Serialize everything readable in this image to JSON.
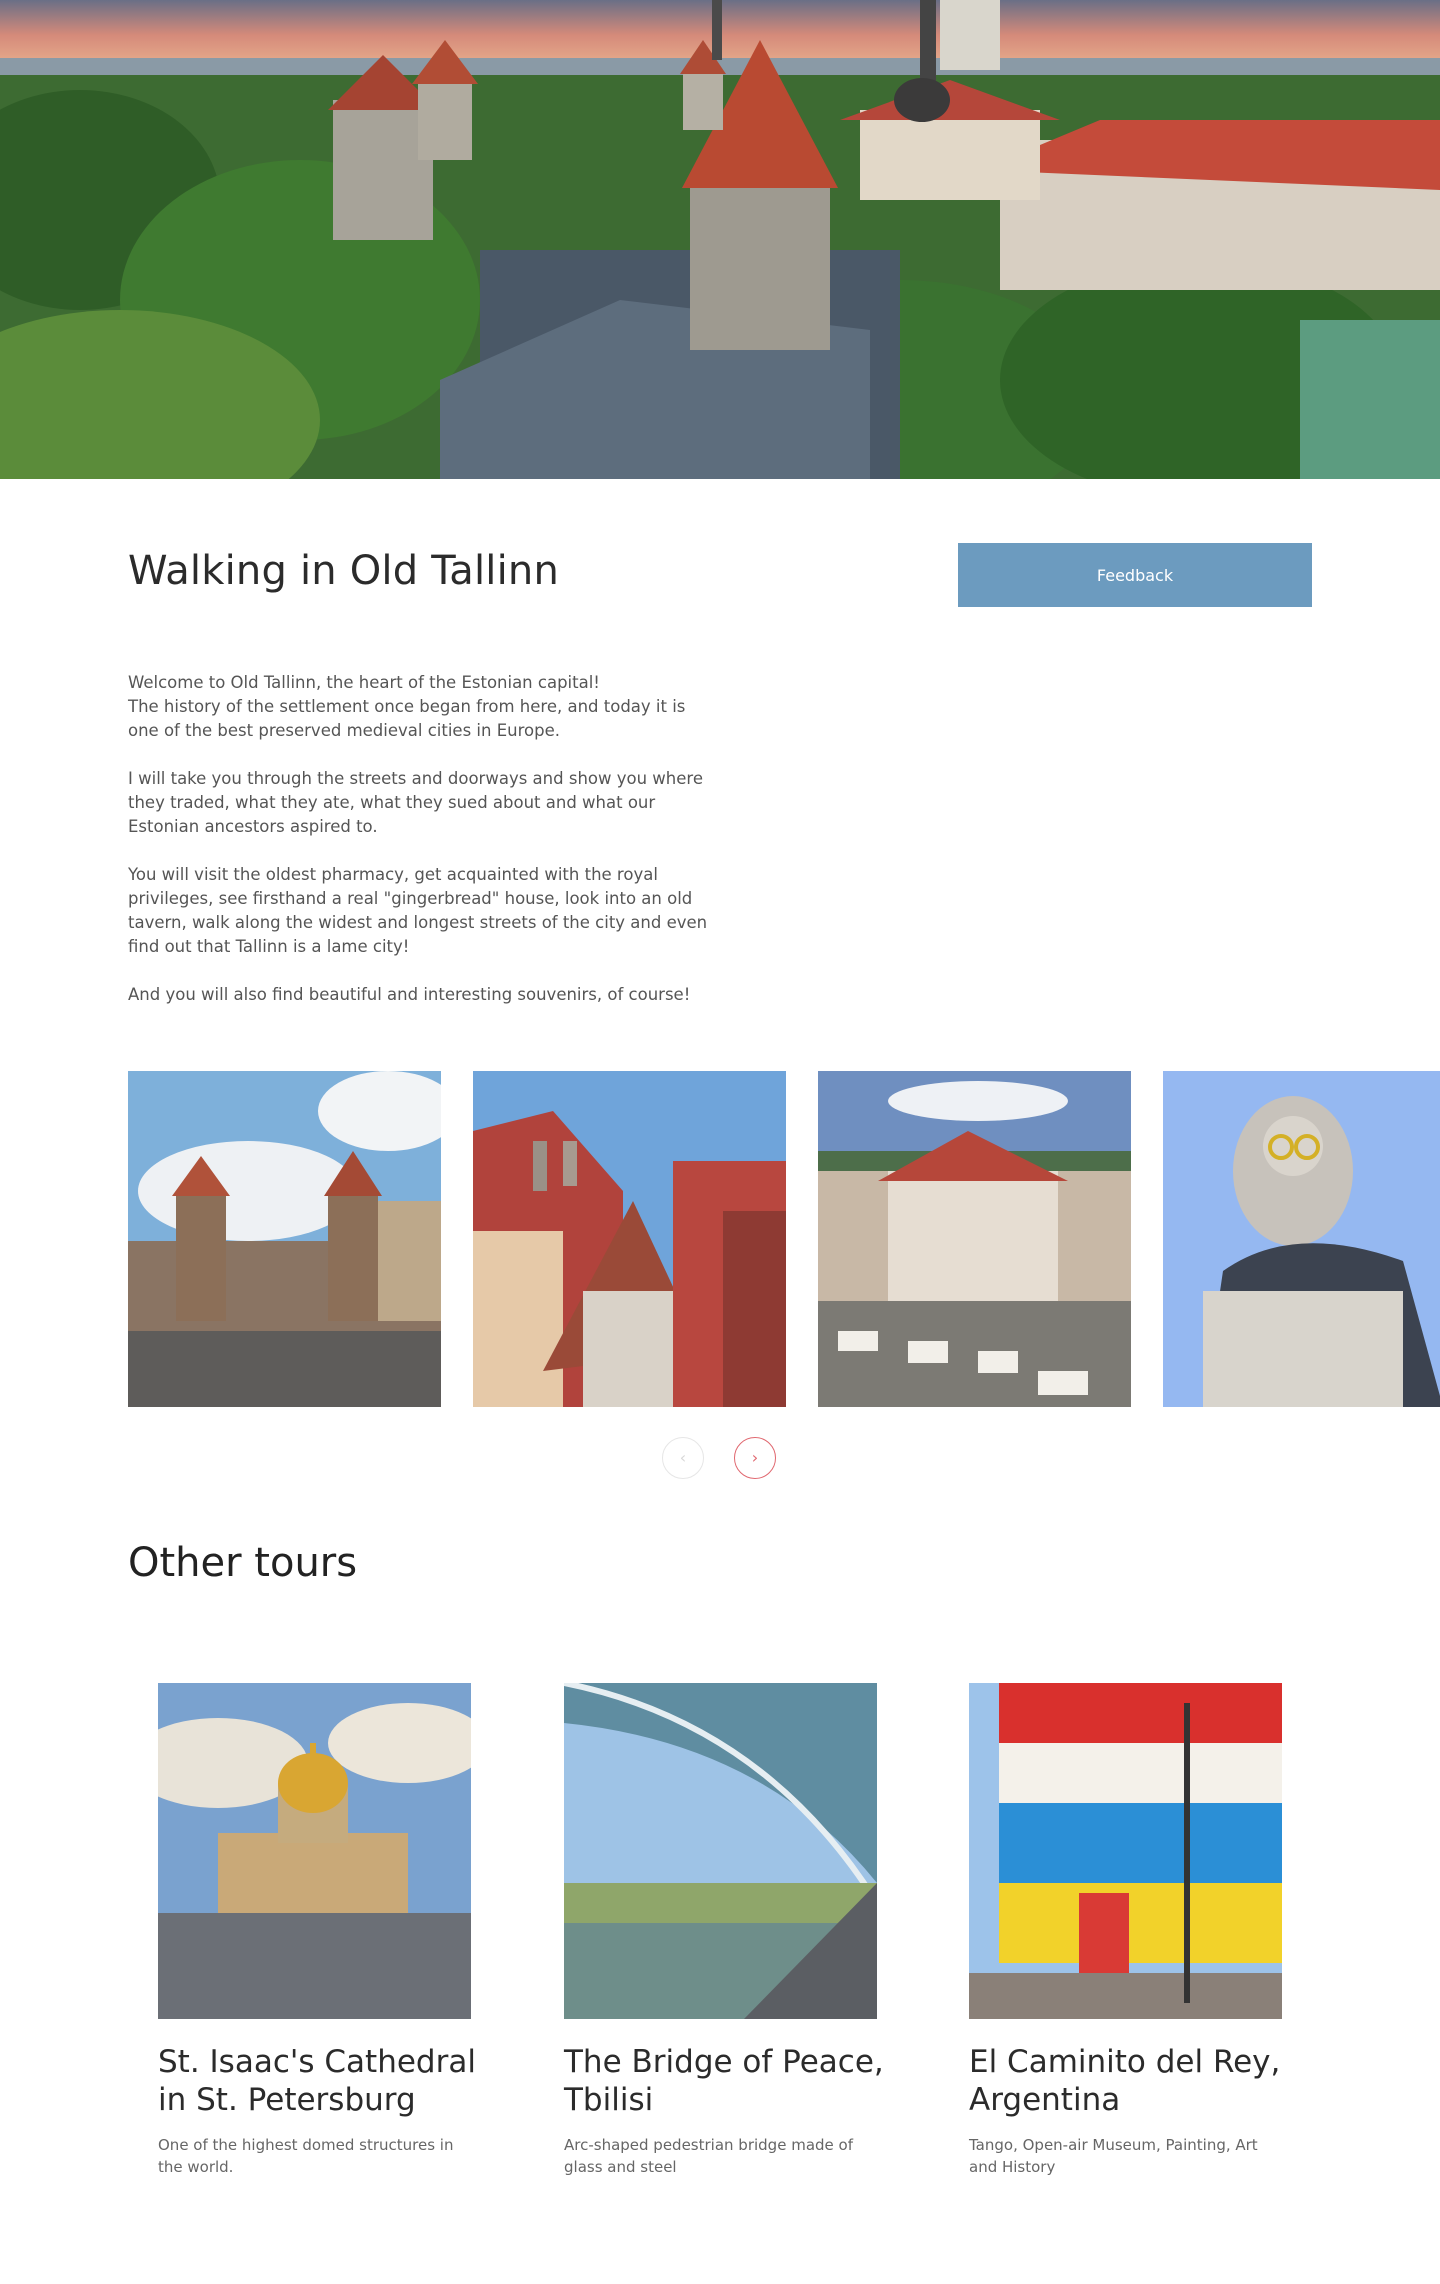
{
  "tour": {
    "title": "Walking in Old Tallinn",
    "feedback_label": "Feedback",
    "description": [
      "Welcome to Old Tallinn, the heart of the Estonian capital!\nThe history of the settlement once began from here, and today it is one of the best preserved medieval cities in Europe.",
      "I will take you through the streets and doorways and show you where they traded, what they ate, what they sued about and what our Estonian ancestors aspired to.",
      "You will visit the oldest pharmacy, get acquainted with the royal privileges, see firsthand a real \"gingerbread\" house, look into an old tavern, walk along the widest and longest streets of the city and even find out that Tallinn is a lame city!",
      "And you will also find beautiful and interesting souvenirs, of course!"
    ]
  },
  "gallery": {
    "prev_icon": "chevron-left-icon",
    "next_icon": "chevron-right-icon",
    "prev_glyph": "‹",
    "next_glyph": "›"
  },
  "other_tours": {
    "heading": "Other tours",
    "items": [
      {
        "title": "St. Isaac's Cathedral in St. Petersburg",
        "description": "One of the highest domed structures in the world."
      },
      {
        "title": "The Bridge of Peace, Tbilisi",
        "description": "Arc-shaped pedestrian bridge made of glass and steel"
      },
      {
        "title": "El Caminito del Rey, Argentina",
        "description": "Tango, Open-air Museum, Painting, Art and History"
      }
    ]
  },
  "colors": {
    "feedback_button": "#6c9bbf",
    "nav_active": "#e0676f",
    "nav_inactive": "#d8d8d8"
  }
}
